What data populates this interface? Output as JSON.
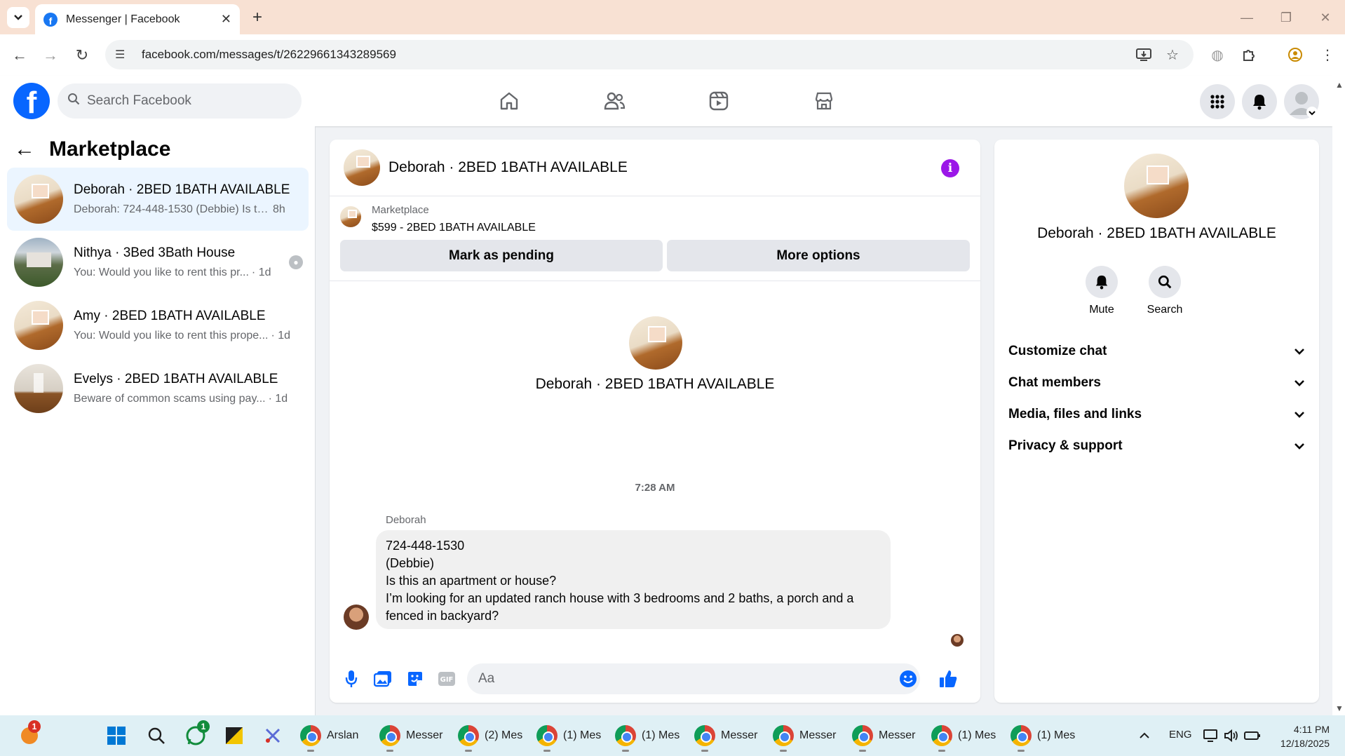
{
  "browser": {
    "tab_title": "Messenger | Facebook",
    "url": "facebook.com/messages/t/26229661343289569"
  },
  "fb": {
    "search_placeholder": "Search Facebook"
  },
  "left": {
    "title": "Marketplace",
    "conversations": [
      {
        "name": "Deborah · 2BED 1BATH AVAILABLE",
        "preview": "Deborah: 724-448-1530 (Debbie) Is th...",
        "time": "8h"
      },
      {
        "name": "Nithya · 3Bed 3Bath House",
        "preview": "You: Would you like to rent this pr...",
        "time": "· 1d"
      },
      {
        "name": "Amy · 2BED 1BATH AVAILABLE",
        "preview": "You: Would you like to rent this prope...",
        "time": "· 1d"
      },
      {
        "name": "Evelys · 2BED 1BATH AVAILABLE",
        "preview": "Beware of common scams using pay...",
        "time": "· 1d"
      }
    ]
  },
  "chat": {
    "title": "Deborah · 2BED 1BATH AVAILABLE",
    "listing_label": "Marketplace",
    "listing_price": "$599 - 2BED 1BATH AVAILABLE",
    "mark_pending": "Mark as pending",
    "more_options": "More options",
    "hero_name": "Deborah · 2BED 1BATH AVAILABLE",
    "timestamp": "7:28 AM",
    "sender": "Deborah",
    "message_lines": [
      "724-448-1530",
      "(Debbie)",
      "Is this an apartment or house?",
      "I’m looking for an updated ranch house with 3 bedrooms and 2 baths, a porch and a",
      "fenced in backyard?"
    ],
    "composer_placeholder": "Aa",
    "accent_color": "#0866ff",
    "info_color": "#9b17e8"
  },
  "right": {
    "name": "Deborah · 2BED 1BATH AVAILABLE",
    "mute": "Mute",
    "search": "Search",
    "sections": [
      "Customize chat",
      "Chat members",
      "Media, files and links",
      "Privacy & support"
    ]
  },
  "taskbar": {
    "apps": [
      "Arslan",
      "Messer",
      "(2) Mes",
      "(1) Mes",
      "(1) Mes",
      "Messer",
      "Messer",
      "Messer",
      "(1) Mes",
      "(1) Mes"
    ],
    "lang": "ENG",
    "time": "4:11 PM",
    "date": "12/18/2025",
    "badge_a": "1",
    "badge_b": "1"
  }
}
